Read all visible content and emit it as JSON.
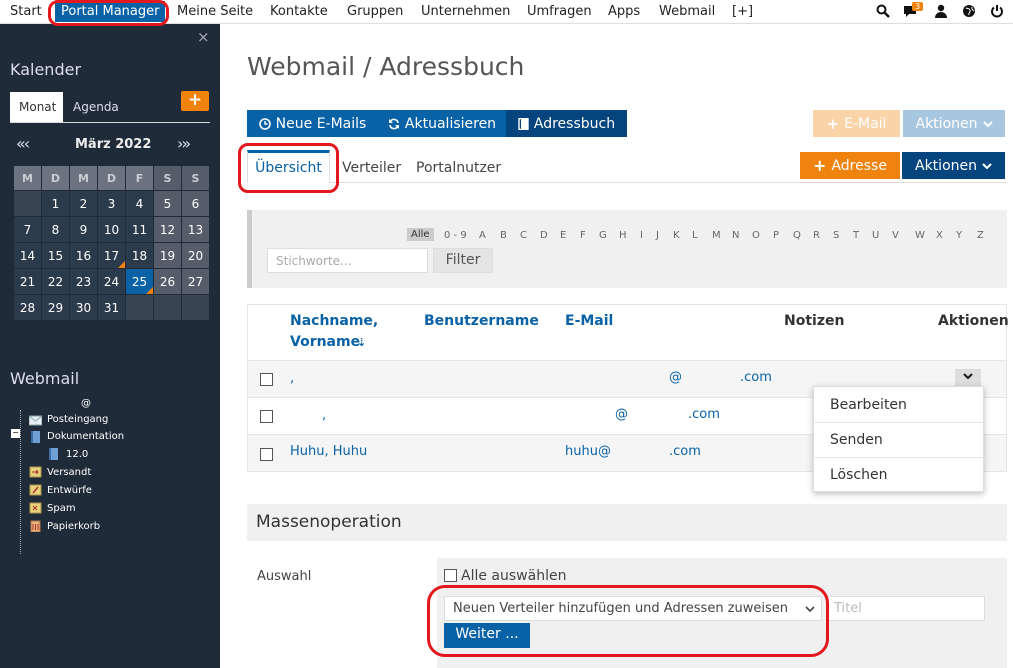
{
  "topnav": {
    "items": [
      "Start",
      "Portal Manager",
      "Meine Seite",
      "Kontakte",
      "Gruppen",
      "Unternehmen",
      "Umfragen",
      "Apps",
      "Webmail",
      "[+]"
    ],
    "notification_count": "3"
  },
  "sidebar": {
    "close": "×",
    "kalender_title": "Kalender",
    "tab_monat": "Monat",
    "tab_agenda": "Agenda",
    "add": "+",
    "prev": "«‹",
    "next": "›»",
    "month": "März 2022",
    "weekdays": [
      "M",
      "D",
      "M",
      "D",
      "F",
      "S",
      "S"
    ],
    "weeks": [
      [
        "",
        "1",
        "2",
        "3",
        "4",
        "5",
        "6"
      ],
      [
        "7",
        "8",
        "9",
        "10",
        "11",
        "12",
        "13"
      ],
      [
        "14",
        "15",
        "16",
        "17",
        "18",
        "19",
        "20"
      ],
      [
        "21",
        "22",
        "23",
        "24",
        "25",
        "26",
        "27"
      ],
      [
        "28",
        "29",
        "30",
        "31",
        "",
        "",
        ""
      ]
    ],
    "webmail_title": "Webmail",
    "account": "@",
    "folders": [
      "Posteingang",
      "Dokumentation",
      "12.0",
      "Versandt",
      "Entwürfe",
      "Spam",
      "Papierkorb"
    ]
  },
  "main": {
    "title": "Webmail / Adressbuch",
    "btn_new_mails": "Neue E-Mails",
    "btn_refresh": "Aktualisieren",
    "btn_addressbook": "Adressbuch",
    "btn_email": "E-Mail",
    "btn_actions_top": "Aktionen",
    "tabs": [
      "Übersicht",
      "Verteiler",
      "Portalnutzer"
    ],
    "btn_adresse": "Adresse",
    "btn_actions": "Aktionen",
    "alpha_alle": "Alle",
    "alpha": [
      "0 - 9",
      "A",
      "B",
      "C",
      "D",
      "E",
      "F",
      "G",
      "H",
      "I",
      "J",
      "K",
      "L",
      "M",
      "N",
      "O",
      "P",
      "Q",
      "R",
      "S",
      "T",
      "U",
      "V",
      "W",
      "X",
      "Y",
      "Z"
    ],
    "keyword_placeholder": "Stichworte...",
    "filter_btn": "Filter",
    "columns": {
      "name_line1": "Nachname,",
      "name_line2": "Vorname",
      "sort": "⇣",
      "username": "Benutzername",
      "email": "E-Mail",
      "notes": "Notizen",
      "actions": "Aktionen"
    },
    "rows": [
      {
        "name": ",",
        "email_user": "@",
        "email_domain": ".com"
      },
      {
        "name": ",",
        "email_user": "@",
        "email_domain": ".com"
      },
      {
        "name": "Huhu, Huhu",
        "email_user": "huhu@",
        "email_domain": ".com"
      }
    ],
    "dropdown": [
      "Bearbeiten",
      "Senden",
      "Löschen"
    ],
    "mass_title": "Massenoperation",
    "auswahl_label": "Auswahl",
    "alle_auswaehlen": "Alle auswählen",
    "select_value": "Neuen Verteiler hinzufügen und Adressen zuweisen",
    "titel_placeholder": "Titel",
    "weiter": "Weiter ..."
  }
}
